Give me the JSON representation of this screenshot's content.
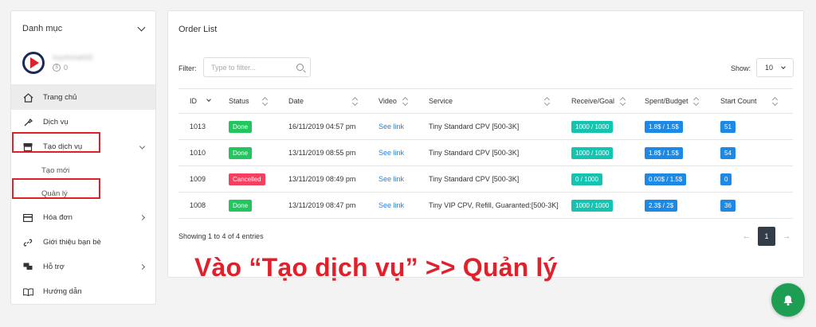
{
  "sidebar": {
    "header": "Danh mục",
    "user": {
      "name": "huynhnhat032",
      "balance": "0"
    },
    "items": [
      {
        "label": "Trang chủ",
        "icon": "home-icon"
      },
      {
        "label": "Dịch vụ",
        "icon": "wrench-icon"
      },
      {
        "label": "Tạo dịch vụ",
        "icon": "store-icon"
      },
      {
        "label": "Hóa đơn",
        "icon": "card-icon"
      },
      {
        "label": "Giới thiệu bạn bè",
        "icon": "link-icon"
      },
      {
        "label": "Hỗ trợ",
        "icon": "chat-icon"
      },
      {
        "label": "Hướng dẫn",
        "icon": "book-icon"
      }
    ],
    "subitems": [
      {
        "label": "Tạo mới"
      },
      {
        "label": "Quản lý"
      }
    ]
  },
  "main": {
    "title": "Order List",
    "filter_label": "Filter:",
    "filter_placeholder": "Type to filter...",
    "show_label": "Show:",
    "show_value": "10",
    "columns": [
      "ID",
      "Status",
      "Date",
      "Video",
      "Service",
      "Receive/Goal",
      "Spent/Budget",
      "Start Count"
    ],
    "rows": [
      {
        "id": "1013",
        "status": "Done",
        "date": "16/11/2019 04:57 pm",
        "video": "See link",
        "service": "Tiny Standard CPV [500-3K]",
        "receive": "1000 / 1000",
        "spent": "1.8$ / 1.5$",
        "start": "51"
      },
      {
        "id": "1010",
        "status": "Done",
        "date": "13/11/2019 08:55 pm",
        "video": "See link",
        "service": "Tiny Standard CPV [500-3K]",
        "receive": "1000 / 1000",
        "spent": "1.8$ / 1.5$",
        "start": "54"
      },
      {
        "id": "1009",
        "status": "Cancelled",
        "date": "13/11/2019 08:49 pm",
        "video": "See link",
        "service": "Tiny Standard CPV [500-3K]",
        "receive": "0 / 1000",
        "spent": "0.00$ / 1.5$",
        "start": "0"
      },
      {
        "id": "1008",
        "status": "Done",
        "date": "13/11/2019 08:47 pm",
        "video": "See link",
        "service": "Tiny VIP CPV, Refill, Guaranted:[500-3K]",
        "receive": "1000 / 1000",
        "spent": "2.3$ / 2$",
        "start": "36"
      }
    ],
    "showing": "Showing 1 to 4 of 4 entries",
    "page": "1",
    "prev": "←",
    "next": "→"
  },
  "annotation": "Vào “Tạo dịch vụ” >> Quản lý",
  "colors": {
    "done": "#22c55e",
    "cancelled": "#f43f5e",
    "receive": "#14c4b0",
    "spent": "#1e88e5",
    "annotation": "#e0202a",
    "bell": "#1e9e52"
  }
}
